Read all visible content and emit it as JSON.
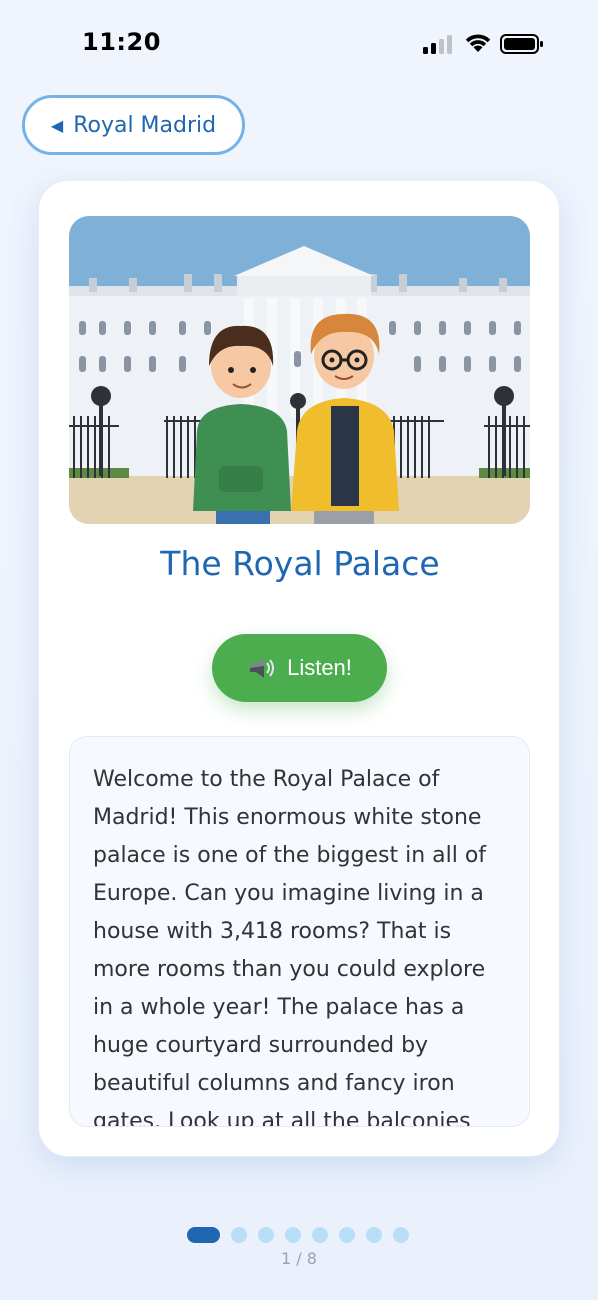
{
  "status_bar": {
    "time": "11:20"
  },
  "header": {
    "back_label": "Royal Madrid"
  },
  "card": {
    "image_alt": "Two cartoon children in front of the white Royal Palace with iron gates",
    "title": "The Royal Palace",
    "listen_label": "Listen!",
    "body_text": "Welcome to the Royal Palace of Madrid! This enormous white stone palace is one of the biggest in all of Europe. Can you imagine living in a house with 3,418 rooms? That is more rooms than you could explore in a whole year! The palace has a huge courtyard surrounded by beautiful columns and fancy iron gates. Look up at all the balconies and windows!"
  },
  "pagination": {
    "current": 1,
    "total": 8,
    "counter_text": "1 / 8"
  },
  "colors": {
    "accent_blue": "#1f67b1",
    "listen_green": "#4cad4f",
    "dot_inactive": "#b9dff6",
    "background": "#eef3fd"
  },
  "icons": {
    "back": "triangle-left-icon",
    "listen": "speaker-icon",
    "signal": "cellular-signal-icon",
    "wifi": "wifi-icon",
    "battery": "battery-icon"
  }
}
